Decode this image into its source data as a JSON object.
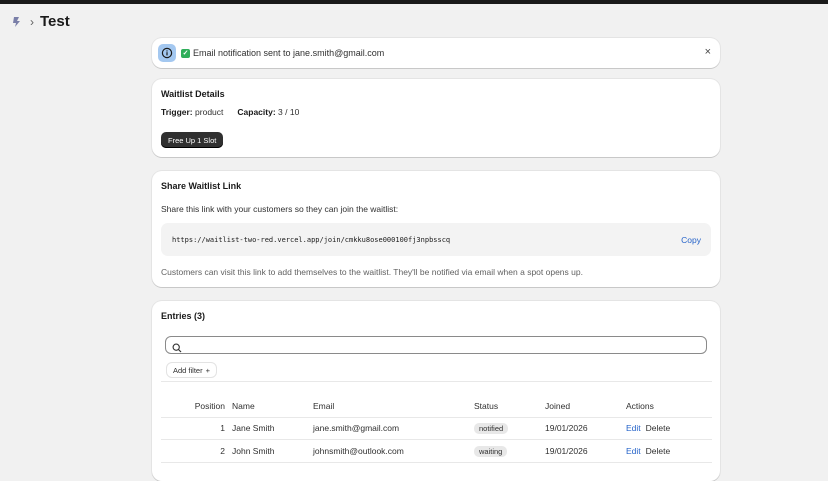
{
  "header": {
    "separator": "›",
    "title": "Test"
  },
  "banner": {
    "message": "Email notification sent to jane.smith@gmail.com",
    "check_glyph": "✓",
    "close_glyph": "×"
  },
  "details": {
    "title": "Waitlist Details",
    "trigger_label": "Trigger:",
    "trigger_value": "product",
    "capacity_label": "Capacity:",
    "capacity_value": "3 / 10",
    "free_button": "Free Up 1 Slot"
  },
  "share": {
    "title": "Share Waitlist Link",
    "description": "Share this link with your customers so they can join the waitlist:",
    "url": "https://waitlist-two-red.vercel.app/join/cmkku8ose000100fj3npbsscq",
    "copy_label": "Copy",
    "note": "Customers can visit this link to add themselves to the waitlist. They'll be notified via email when a spot opens up."
  },
  "entries": {
    "title": "Entries (3)",
    "search_placeholder": "",
    "add_filter_label": "Add filter",
    "add_filter_glyph": "+",
    "columns": [
      "Position",
      "Name",
      "Email",
      "Status",
      "Joined",
      "Actions"
    ],
    "rows": [
      {
        "position": "1",
        "name": "Jane Smith",
        "email": "jane.smith@gmail.com",
        "status": "notified",
        "joined": "19/01/2026",
        "edit": "Edit",
        "delete": "Delete"
      },
      {
        "position": "2",
        "name": "John Smith",
        "email": "johnsmith@outlook.com",
        "status": "waiting",
        "joined": "19/01/2026",
        "edit": "Edit",
        "delete": "Delete"
      }
    ]
  },
  "colors": {
    "accent_link": "#2563c9",
    "dark_button": "#303030",
    "info_badge": "#a4c8f0",
    "check_green": "#2fae5a"
  },
  "icons": [
    "app-icon",
    "info-icon",
    "check-icon",
    "close-icon",
    "search-icon",
    "plus-icon"
  ]
}
